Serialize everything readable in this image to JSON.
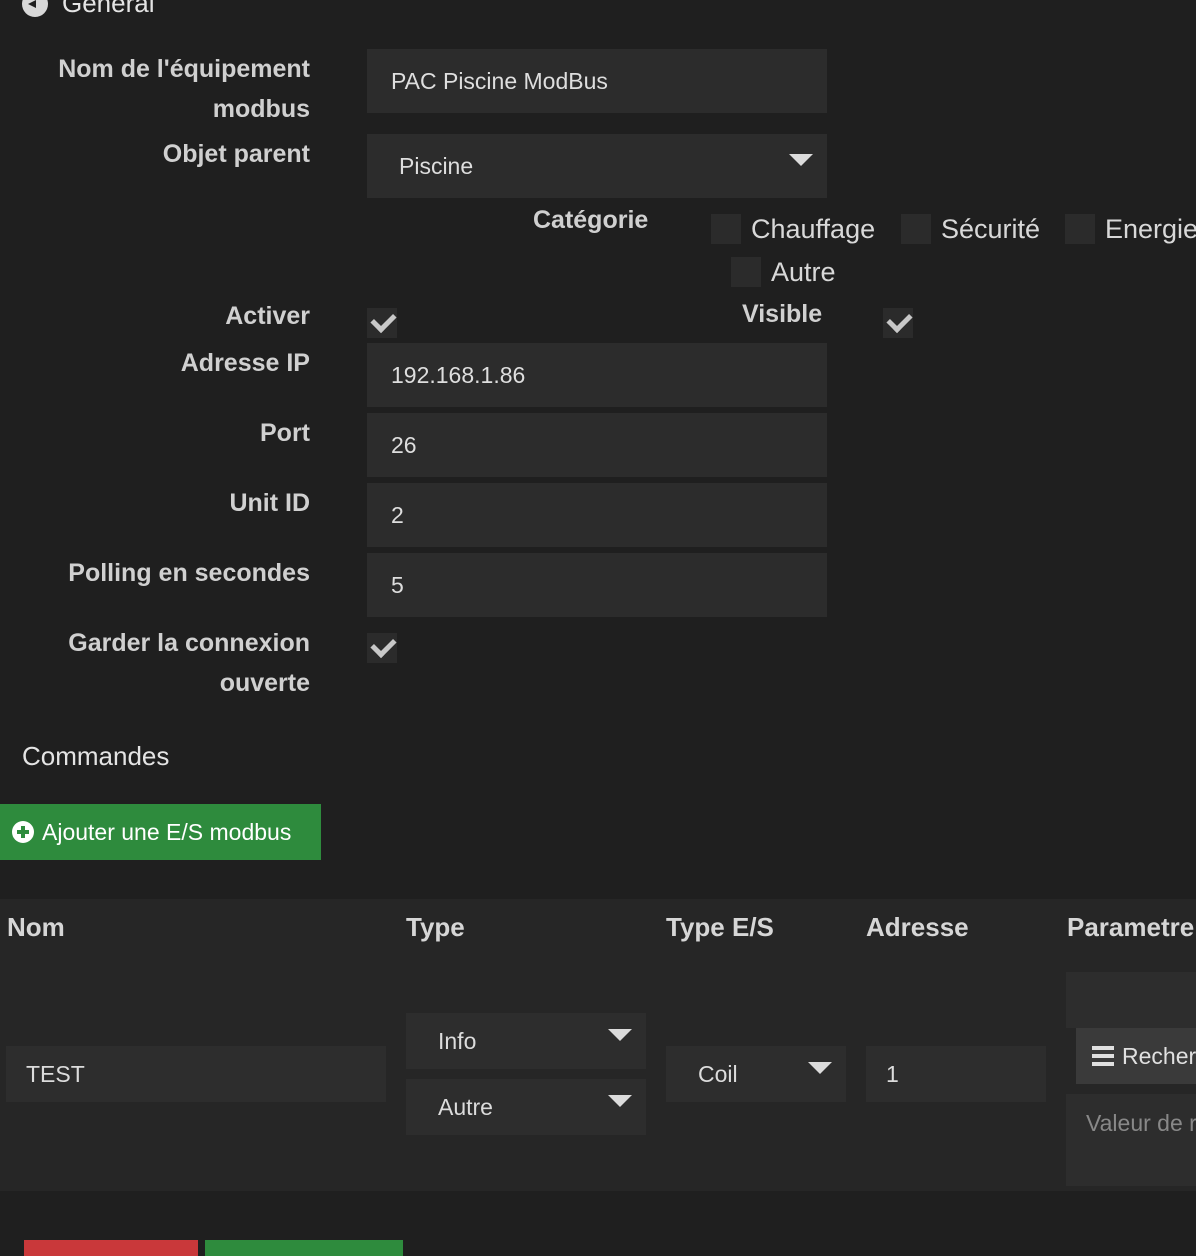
{
  "general": {
    "title": "Général",
    "fields": {
      "name_label_line1": "Nom de l'équipement",
      "name_label_line2": "modbus",
      "name_value": "PAC Piscine ModBus",
      "parent_label": "Objet parent",
      "parent_value": "Piscine",
      "category_label": "Catégorie",
      "categories": [
        "Chauffage",
        "Sécurité",
        "Energie",
        "Autre"
      ],
      "activate_label": "Activer",
      "visible_label": "Visible",
      "ip_label": "Adresse IP",
      "ip_value": "192.168.1.86",
      "port_label": "Port",
      "port_value": "26",
      "unit_label": "Unit ID",
      "unit_value": "2",
      "polling_label": "Polling en secondes",
      "polling_value": "5",
      "keep_label_line1": "Garder la connexion",
      "keep_label_line2": "ouverte"
    }
  },
  "commands": {
    "title": "Commandes",
    "add_button": "Ajouter une E/S modbus",
    "columns": [
      "Nom",
      "Type",
      "Type E/S",
      "Adresse",
      "Parametre"
    ],
    "row": {
      "name": "TEST",
      "type": "Info",
      "subtype": "Autre",
      "io_type": "Coil",
      "address": "1",
      "search_button": "Recher",
      "value_placeholder": "Valeur de r"
    }
  },
  "colors": {
    "background": "#1f1f1f",
    "input": "#2c2c2c",
    "green": "#2e8b3d",
    "red": "#c9383a"
  }
}
